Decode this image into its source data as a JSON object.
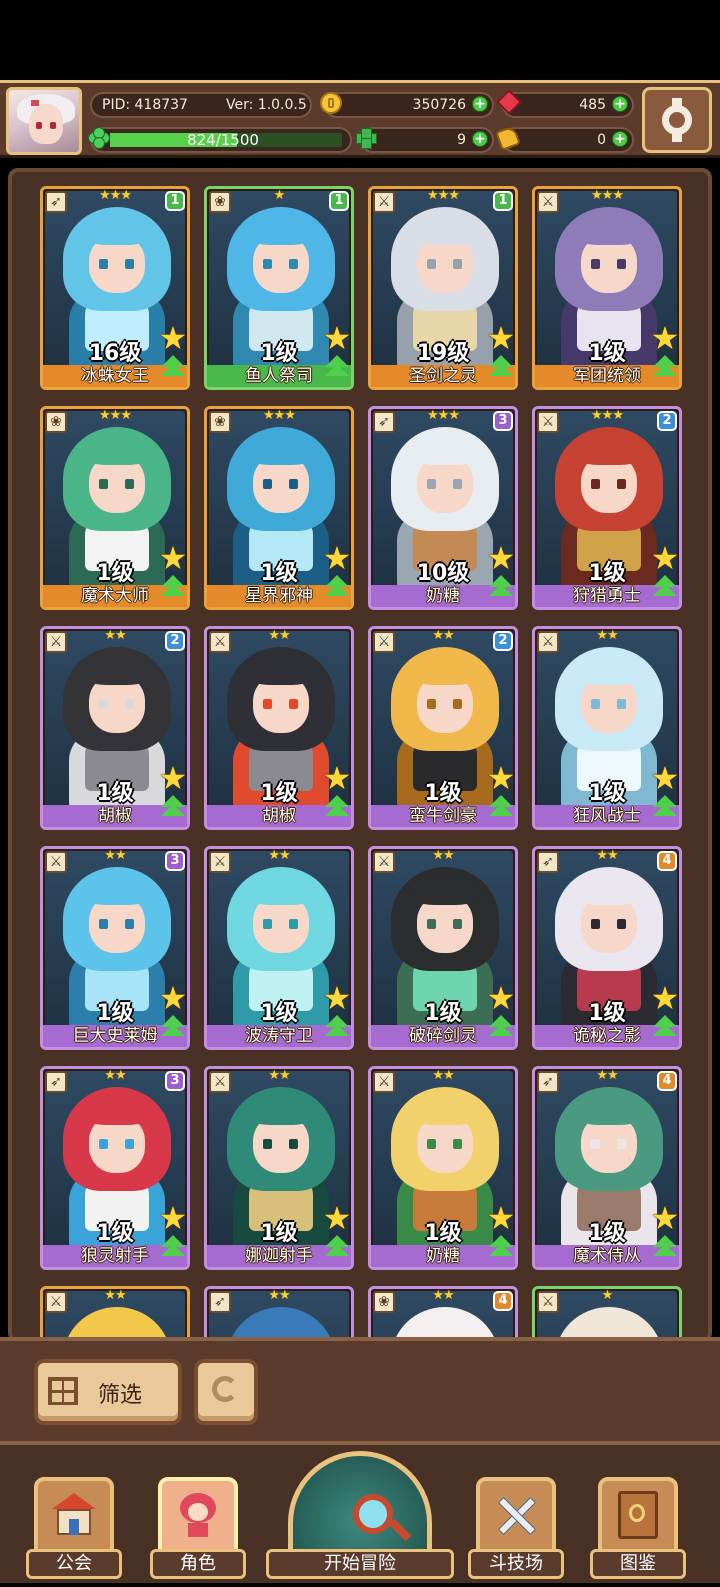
{
  "header": {
    "pid": "PID: 418737",
    "version": "Ver: 1.0.0.5",
    "gold": "350726",
    "gems": "485",
    "exp_text": "824/1500",
    "exp_progress": 0.549,
    "clover": "9",
    "keys": "0"
  },
  "heroes": [
    {
      "name": "冰蛛女王",
      "level": "16级",
      "stars": "★★★",
      "badge": "1",
      "frame": "orange",
      "class": "bow",
      "palette": [
        "#62c4e6",
        "#2a7fa9",
        "#bfefff"
      ]
    },
    {
      "name": "鱼人祭司",
      "level": "1级",
      "stars": "★",
      "badge": "1",
      "frame": "green",
      "class": "staff",
      "palette": [
        "#4fb6e8",
        "#2f89b0",
        "#cfe8f0"
      ]
    },
    {
      "name": "圣剑之灵",
      "level": "19级",
      "stars": "★★★",
      "badge": "1",
      "frame": "orange",
      "class": "sword",
      "palette": [
        "#d8dde6",
        "#98a0ab",
        "#e7d6a8"
      ]
    },
    {
      "name": "军团统领",
      "level": "1级",
      "stars": "★★★",
      "badge": "",
      "frame": "orange",
      "class": "sword",
      "palette": [
        "#8d7cb8",
        "#463a6b",
        "#e8e3f0"
      ]
    },
    {
      "name": "魔术大师",
      "level": "1级",
      "stars": "★★★",
      "badge": "",
      "frame": "orange",
      "class": "staff",
      "palette": [
        "#4bb58a",
        "#2c6a55",
        "#f3f3f3"
      ]
    },
    {
      "name": "星界邪神",
      "level": "1级",
      "stars": "★★★",
      "badge": "",
      "frame": "orange",
      "class": "staff",
      "palette": [
        "#3fa9d8",
        "#1d5e86",
        "#b5e8f6"
      ]
    },
    {
      "name": "奶糖",
      "level": "10级",
      "stars": "★★★",
      "badge": "3",
      "frame": "purple",
      "class": "bow",
      "palette": [
        "#e7ecf0",
        "#9aa6b0",
        "#c48a55"
      ]
    },
    {
      "name": "狩猎勇士",
      "level": "1级",
      "stars": "★★★",
      "badge": "2",
      "frame": "purple",
      "class": "sword",
      "palette": [
        "#c64333",
        "#6a2a20",
        "#cfa24a"
      ]
    },
    {
      "name": "胡椒",
      "level": "1级",
      "stars": "★★",
      "badge": "2",
      "frame": "purple",
      "class": "sword",
      "palette": [
        "#343438",
        "#d9d9dc",
        "#8a8a90"
      ]
    },
    {
      "name": "胡椒",
      "level": "1级",
      "stars": "★★",
      "badge": "",
      "frame": "purple",
      "class": "sword",
      "palette": [
        "#2f2f36",
        "#e04a2e",
        "#8a8a90"
      ]
    },
    {
      "name": "蛮牛剑豪",
      "level": "1级",
      "stars": "★★",
      "badge": "2",
      "frame": "purple",
      "class": "sword",
      "palette": [
        "#f0b84a",
        "#a86a1d",
        "#2a2a2e"
      ]
    },
    {
      "name": "狂风战士",
      "level": "1级",
      "stars": "★★",
      "badge": "",
      "frame": "purple",
      "class": "sword",
      "palette": [
        "#c9e9f6",
        "#7fb8d0",
        "#eef7fb"
      ]
    },
    {
      "name": "巨大史莱姆",
      "level": "1级",
      "stars": "★★",
      "badge": "3",
      "frame": "purple",
      "class": "sword",
      "palette": [
        "#5cc3ea",
        "#2d7fab",
        "#a8e4f7"
      ]
    },
    {
      "name": "波涛守卫",
      "level": "1级",
      "stars": "★★",
      "badge": "",
      "frame": "purple",
      "class": "sword",
      "palette": [
        "#6fd7e0",
        "#2f9aa8",
        "#bff0f2"
      ]
    },
    {
      "name": "破碎剑灵",
      "level": "1级",
      "stars": "★★",
      "badge": "",
      "frame": "purple",
      "class": "sword",
      "palette": [
        "#2b2d2f",
        "#3e6d55",
        "#6cd5b0"
      ]
    },
    {
      "name": "诡秘之影",
      "level": "1级",
      "stars": "★★",
      "badge": "4",
      "frame": "purple",
      "class": "bow",
      "palette": [
        "#e9e6ef",
        "#2c2a33",
        "#b83a4e"
      ]
    },
    {
      "name": "狼灵射手",
      "level": "1级",
      "stars": "★★",
      "badge": "3",
      "frame": "purple",
      "class": "bow",
      "palette": [
        "#d8384a",
        "#3aa4d8",
        "#f2f2f2"
      ]
    },
    {
      "name": "娜迦射手",
      "level": "1级",
      "stars": "★★",
      "badge": "",
      "frame": "purple",
      "class": "sword",
      "palette": [
        "#2f8a78",
        "#184a40",
        "#d9c07a"
      ]
    },
    {
      "name": "奶糖",
      "level": "1级",
      "stars": "★★",
      "badge": "",
      "frame": "purple",
      "class": "sword",
      "palette": [
        "#f2d06a",
        "#3a8a48",
        "#c77a3a"
      ]
    },
    {
      "name": "魔术侍从",
      "level": "1级",
      "stars": "★★",
      "badge": "4",
      "frame": "purple",
      "class": "bow",
      "palette": [
        "#4a9a82",
        "#e9e5ea",
        "#9a7a6a"
      ]
    },
    {
      "name": "",
      "level": "",
      "stars": "★★",
      "badge": "",
      "frame": "orange",
      "class": "sword",
      "palette": [
        "#f2c84a",
        "#b88a1d",
        "#fff0b0"
      ]
    },
    {
      "name": "",
      "level": "",
      "stars": "★★",
      "badge": "",
      "frame": "purple",
      "class": "bow",
      "palette": [
        "#3a7ab8",
        "#1d3a5e",
        "#b5d8f0"
      ]
    },
    {
      "name": "",
      "level": "",
      "stars": "★★",
      "badge": "4",
      "frame": "purple",
      "class": "staff",
      "palette": [
        "#f3eef0",
        "#c94a4a",
        "#d8c0b0"
      ]
    },
    {
      "name": "",
      "level": "",
      "stars": "★",
      "badge": "",
      "frame": "green",
      "class": "sword",
      "palette": [
        "#efe6d8",
        "#c6a070",
        "#b83a3a"
      ]
    }
  ],
  "toolbar": {
    "filter_label": "筛选"
  },
  "nav": {
    "guild": "公会",
    "roles": "角色",
    "adventure": "开始冒险",
    "arena": "斗技场",
    "codex": "图鉴"
  },
  "colors": {
    "frame_orange": "#e8a33d",
    "frame_green": "#7ad46a",
    "frame_purple": "#c58fe0",
    "badge_1": "#49b84a",
    "badge_2": "#3b8fd6",
    "badge_3": "#9a5fcf",
    "badge_4": "#e08a2a"
  }
}
